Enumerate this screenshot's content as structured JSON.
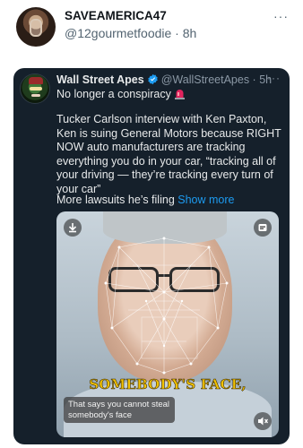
{
  "outer_tweet": {
    "display_name": "SAVEAMERICA47",
    "handle_time": "@12gourmetfoodie · 8h",
    "more": "···"
  },
  "quoted_tweet": {
    "display_name": "Wall Street Apes",
    "handle_time": "@WallStreetApes · 5h",
    "more": "···",
    "subtitle": "No longer a conspiracy",
    "body": "Tucker Carlson interview with Ken Paxton, Ken is suing General Motors because RIGHT NOW auto manufacturers are tracking everything you do in your car, “tracking all of your driving — they’re tracking every turn of your car”",
    "lawsuits_text": "More lawsuits he’s filing",
    "show_more": "Show more",
    "verified_color": "#1d9bf0"
  },
  "media": {
    "caption_big": "SOMEBODY'S FACE,",
    "subtitle": "That says you cannot steal somebody's face",
    "icons": [
      "download-icon",
      "gif-icon",
      "volume-icon"
    ]
  }
}
